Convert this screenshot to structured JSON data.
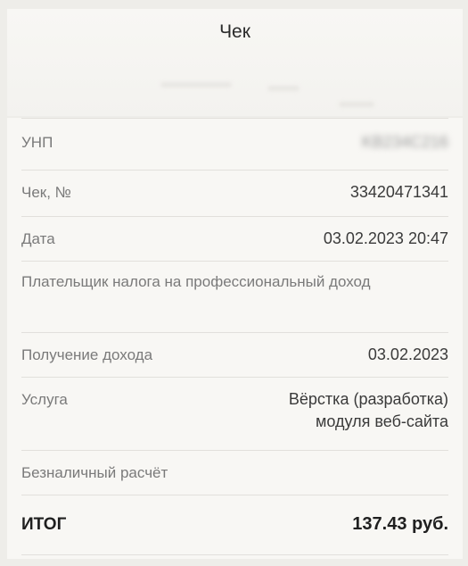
{
  "header": {
    "title": "Чек"
  },
  "receipt": {
    "rows": [
      {
        "label": "УНП",
        "value": "KB234C216"
      },
      {
        "label": "Чек, №",
        "value": "33420471341"
      },
      {
        "label": "Дата",
        "value": "03.02.2023 20:47"
      },
      {
        "label": "Плательщик налога на профессиональный доход",
        "value": ""
      },
      {
        "label": "Получение дохода",
        "value": "03.02.2023"
      },
      {
        "label": "Услуга",
        "value_line1": "Вёрстка (разработка)",
        "value_line2": "модуля веб-сайта"
      },
      {
        "label": "Безналичный расчёт",
        "value": ""
      }
    ],
    "total": {
      "label": "ИТОГ",
      "value": "137.43 руб."
    }
  },
  "colors": {
    "background": "#eeede9",
    "card": "#f8f7f4",
    "divider": "#e2e0dc",
    "label_text": "#7a7a7a",
    "value_text": "#3a3a3a"
  }
}
